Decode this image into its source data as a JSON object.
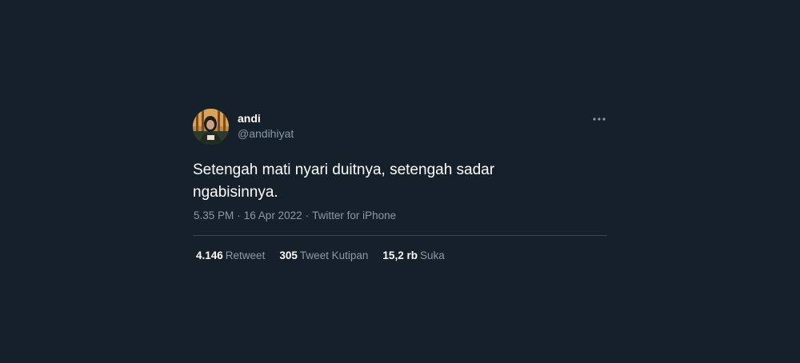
{
  "author": {
    "display_name": "andi",
    "handle": "@andihiyat",
    "avatar_icon": "profile-photo"
  },
  "tweet": {
    "text": "Setengah mati nyari duitnya, setengah sadar ngabisinnya.",
    "time": "5.35 PM",
    "date": "16 Apr 2022",
    "source": "Twitter for iPhone",
    "separator": "·"
  },
  "stats": {
    "retweets": {
      "count": "4.146",
      "label": "Retweet"
    },
    "quotes": {
      "count": "305",
      "label": "Tweet Kutipan"
    },
    "likes": {
      "count": "15,2 rb",
      "label": "Suka"
    }
  },
  "icons": {
    "more": "more-horizontal-icon"
  },
  "colors": {
    "background": "#15202b",
    "text_primary": "#ffffff",
    "text_secondary": "#8b98a5",
    "divider": "#38444d"
  }
}
